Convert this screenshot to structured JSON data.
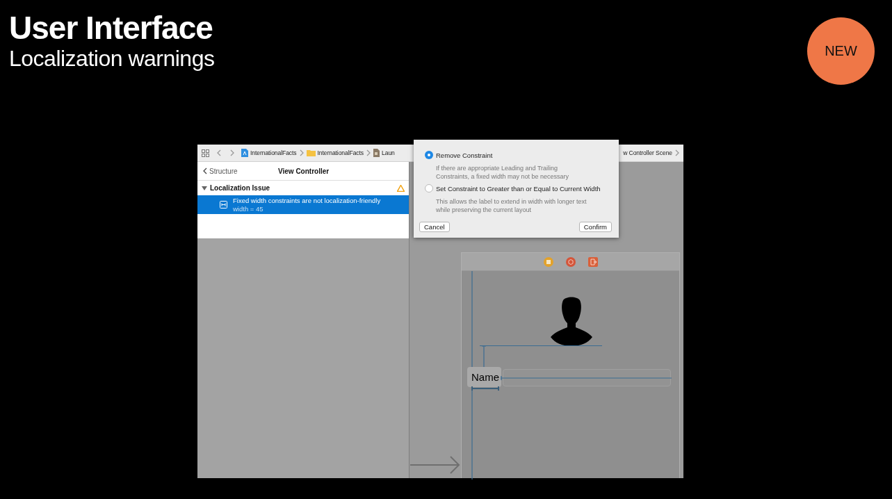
{
  "slide": {
    "title": "User Interface",
    "subtitle": "Localization warnings",
    "badge": "NEW"
  },
  "toolbar": {
    "breadcrumbs": [
      {
        "label": "InternationalFacts",
        "kind": "project"
      },
      {
        "label": "InternationalFacts",
        "kind": "folder"
      },
      {
        "label": "Laun",
        "kind": "file"
      }
    ],
    "trailing_crumb": "w Controller Scene"
  },
  "navigator": {
    "back_label": "Structure",
    "title": "View Controller",
    "group": {
      "label": "Localization Issue",
      "expanded": true,
      "issues": [
        {
          "title": "Fixed width constraints are not localization-friendly",
          "detail": "width = 45",
          "selected": true
        }
      ]
    }
  },
  "popover": {
    "options": [
      {
        "label": "Remove Constraint",
        "description": "If there are appropriate Leading and Trailing\nConstraints, a fixed width may not be necessary",
        "selected": true
      },
      {
        "label": "Set Constraint to Greater than or Equal to Current Width",
        "description": "This allows the label to extend in width with longer text\nwhile preserving the current layout",
        "selected": false
      }
    ],
    "buttons": [
      "Cancel",
      "Confirm"
    ]
  },
  "canvas": {
    "label_text": "Name"
  }
}
